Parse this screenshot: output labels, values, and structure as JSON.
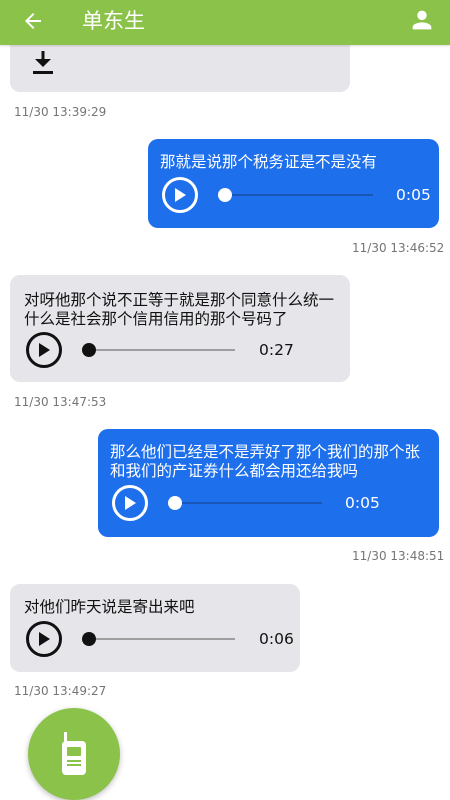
{
  "header": {
    "title": "单东生",
    "back_icon": "arrow-left-icon",
    "profile_icon": "person-icon",
    "color": "#8bc34a"
  },
  "messages": [
    {
      "direction": "in",
      "text": "",
      "timestamp": "11/30 13:39:29",
      "icon": "download-icon"
    },
    {
      "direction": "out",
      "text": "那就是说那个税务证是不是没有",
      "duration": "0:05",
      "timestamp": "11/30 13:46:52"
    },
    {
      "direction": "in",
      "text": "对呀他那个说不正等于就是那个同意什么统一什么是社会那个信用信用的那个号码了",
      "duration": "0:27",
      "timestamp": "11/30 13:47:53"
    },
    {
      "direction": "out",
      "text": "那么他们已经是不是弄好了那个我们的那个张和我们的产证券什么都会用还给我吗",
      "duration": "0:05",
      "timestamp": "11/30 13:48:51"
    },
    {
      "direction": "in",
      "text": "对他们昨天说是寄出来吧",
      "duration": "0:06",
      "timestamp": "11/30 13:49:27"
    }
  ],
  "colors": {
    "incoming": "#e5e5ea",
    "outgoing": "#1e6fec"
  },
  "fab": {
    "icon": "walkie-talkie-icon"
  }
}
